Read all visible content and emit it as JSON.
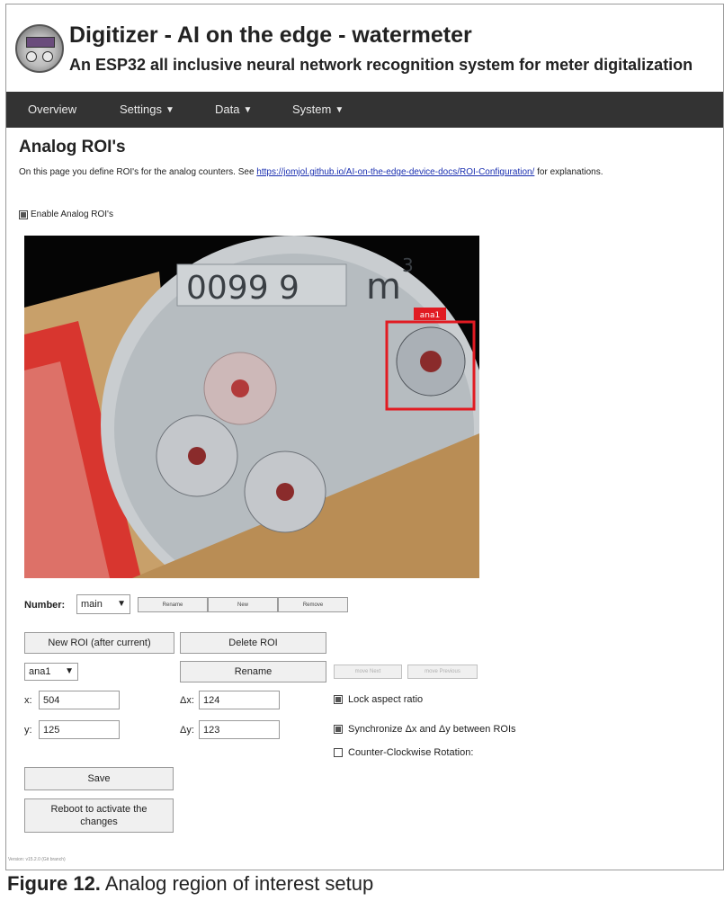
{
  "header": {
    "title": "Digitizer - AI on the edge - watermeter",
    "subtitle": "An ESP32 all inclusive neural network recognition system for meter digitalization"
  },
  "nav": {
    "items": [
      {
        "label": "Overview"
      },
      {
        "label": "Settings"
      },
      {
        "label": "Data"
      },
      {
        "label": "System"
      }
    ]
  },
  "page": {
    "heading": "Analog ROI's",
    "intro_text": "On this page you define ROI's for the analog counters. See",
    "intro_link": "https://jomjol.github.io/AI-on-the-edge-device-docs/ROI-Configuration/",
    "intro_after": "for explanations.",
    "enable_label": "Enable Analog ROI's"
  },
  "image": {
    "meter_digits": "0099 9",
    "meter_unit": "m",
    "unit_exp": "3",
    "roi_label": "ana1"
  },
  "number_row": {
    "label": "Number:",
    "selected": "main",
    "rename_label": "Rename",
    "new_label": "New",
    "remove_label": "Remove"
  },
  "roi_controls": {
    "new_roi_label": "New ROI (after current)",
    "delete_roi_label": "Delete ROI",
    "selected_roi": "ana1",
    "rename_label": "Rename",
    "move_next_label": "move Next",
    "move_prev_label": "move Previous",
    "x_label": "x:",
    "x_value": "504",
    "y_label": "y:",
    "y_value": "125",
    "dx_label": "Δx:",
    "dx_value": "124",
    "dy_label": "Δy:",
    "dy_value": "123",
    "lock_aspect_label": "Lock aspect ratio",
    "sync_label": "Synchronize Δx and Δy between ROIs",
    "ccw_label": "Counter-Clockwise Rotation:",
    "save_label": "Save",
    "reboot_label": "Reboot to activate the changes"
  },
  "footer": {
    "version_text": "Version: v15.2.0 (Git branch)"
  },
  "caption": {
    "label": "Figure 12.",
    "text": "Analog region of interest setup"
  },
  "colors": {
    "navbar": "#333333",
    "roi_box": "#e11b22",
    "link": "#1a2fb0"
  }
}
